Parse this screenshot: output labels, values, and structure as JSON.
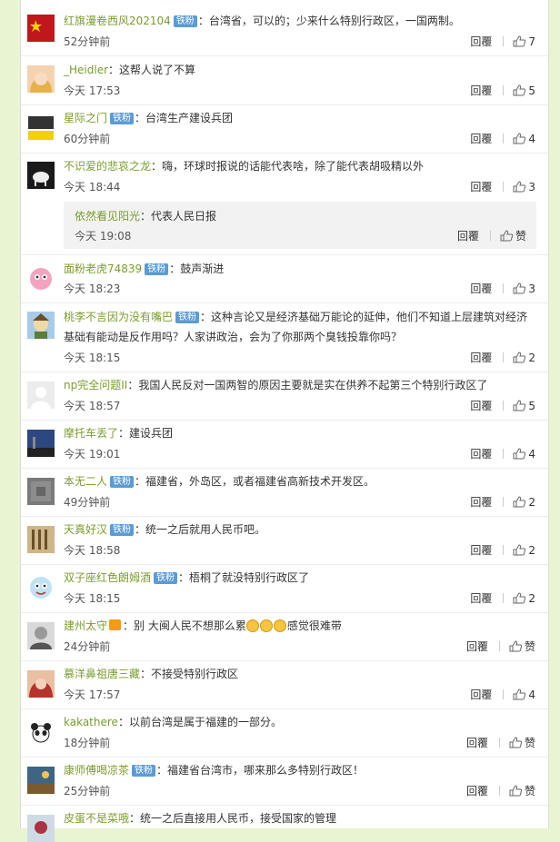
{
  "colors": {
    "page_bg": "#e8f4d2",
    "username": "#7b9c2f",
    "badge": "#5b9bd5"
  },
  "badge_label": "铁粉",
  "reply_label": "回覆",
  "like_icon": "thumbs-up-icon",
  "comments": [
    {
      "user": "红旗漫卷西风202104",
      "badge": true,
      "text": "：台湾省，可以的；少来什么特别行政区，一国两制。",
      "time": "52分钟前",
      "likes": "7"
    },
    {
      "user": "_Heidler",
      "badge": false,
      "text": "：这帮人说了不算",
      "time": "今天 17:53",
      "likes": "5"
    },
    {
      "user": "星际之门",
      "badge": true,
      "text": "：台湾生产建设兵团",
      "time": "60分钟前",
      "likes": "4"
    },
    {
      "user": "不识爱的悲哀之龙",
      "badge": false,
      "text": "：嗨，环球时报说的话能代表啥，除了能代表胡吸精以外",
      "time": "今天 18:44",
      "likes": "3"
    },
    {
      "user": "面粉老虎74839",
      "badge": true,
      "text": "：鼓声渐进",
      "time": "今天 18:23",
      "likes": "3"
    },
    {
      "user": "桃李不言因为没有嘴巴",
      "badge": true,
      "text": "：这种言论又是经济基础万能论的延伸，他们不知道上层建筑对经济",
      "text2": "基础有能动是反作用吗？人家讲政治，会为了你那两个臭钱投靠你吗？",
      "time": "今天 18:15",
      "likes": "2"
    },
    {
      "user": "np完全问题II",
      "badge": false,
      "text": "：我国人民反对一国两智的原因主要就是实在供养不起第三个特别行政区了",
      "time": "今天 18:57",
      "likes": "5"
    },
    {
      "user": "摩托车丢了",
      "badge": false,
      "text": "：建设兵团",
      "time": "今天 19:01",
      "likes": "4"
    },
    {
      "user": "本无二人",
      "badge": true,
      "text": "：福建省，外岛区，或者福建省高新技术开发区。",
      "time": "49分钟前",
      "likes": "2"
    },
    {
      "user": "天真好汉",
      "badge": true,
      "text": "：统一之后就用人民币吧。",
      "time": "今天 18:58",
      "likes": "2"
    },
    {
      "user": "双子座红色朗姆酒",
      "badge": true,
      "text": "：梧桐了就没特别行政区了",
      "time": "今天 18:15",
      "likes": "2"
    },
    {
      "user": "建州太守",
      "badge": false,
      "text": "：别 大闽人民不想那么累",
      "text_after": "感觉很难带",
      "time": "24分钟前",
      "likes": "赞"
    },
    {
      "user": "慕洋鼻祖唐三藏",
      "badge": false,
      "text": "：不接受特别行政区",
      "time": "今天 17:57",
      "likes": "4"
    },
    {
      "user": "kakathere",
      "badge": false,
      "text": "：以前台湾是属于福建的一部分。",
      "time": "18分钟前",
      "likes": "赞"
    },
    {
      "user": "康师傅喝凉茶",
      "badge": true,
      "text": "：福建省台湾市，哪来那么多特别行政区！",
      "time": "25分钟前",
      "likes": "赞"
    },
    {
      "user": "皮蛋不是菜哦",
      "badge": false,
      "text": "：统一之后直接用人民币，接受国家的管理",
      "time": "",
      "likes": ""
    }
  ],
  "sub_reply": {
    "user": "依然看见阳光",
    "text": "：代表人民日报",
    "time": "今天 19:08",
    "likes": "赞"
  }
}
